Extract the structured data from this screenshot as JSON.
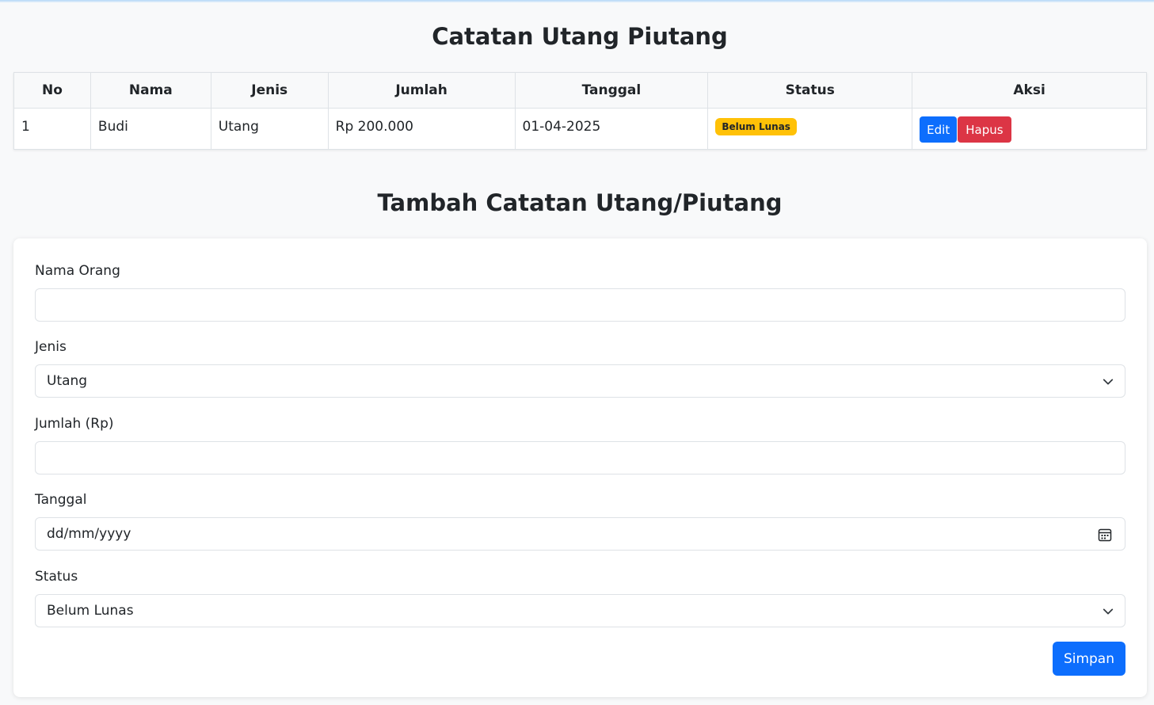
{
  "page": {
    "title": "Catatan Utang Piutang"
  },
  "table": {
    "headers": [
      "No",
      "Nama",
      "Jenis",
      "Jumlah",
      "Tanggal",
      "Status",
      "Aksi"
    ],
    "rows": [
      {
        "no": "1",
        "nama": "Budi",
        "jenis": "Utang",
        "jumlah": "Rp 200.000",
        "tanggal": "01-04-2025",
        "status": "Belum Lunas",
        "edit": "Edit",
        "hapus": "Hapus"
      }
    ]
  },
  "form": {
    "title": "Tambah Catatan Utang/Piutang",
    "nama_label": "Nama Orang",
    "nama_value": "",
    "jenis_label": "Jenis",
    "jenis_value": "Utang",
    "jumlah_label": "Jumlah (Rp)",
    "jumlah_value": "",
    "tanggal_label": "Tanggal",
    "tanggal_placeholder": "dd/mm/yyyy",
    "status_label": "Status",
    "status_value": "Belum Lunas",
    "submit_label": "Simpan"
  },
  "icons": {
    "select": "chevron-down-icon",
    "date": "calendar-icon"
  },
  "colors": {
    "primary": "#0d6efd",
    "danger": "#dc3545",
    "warning": "#ffc107"
  }
}
